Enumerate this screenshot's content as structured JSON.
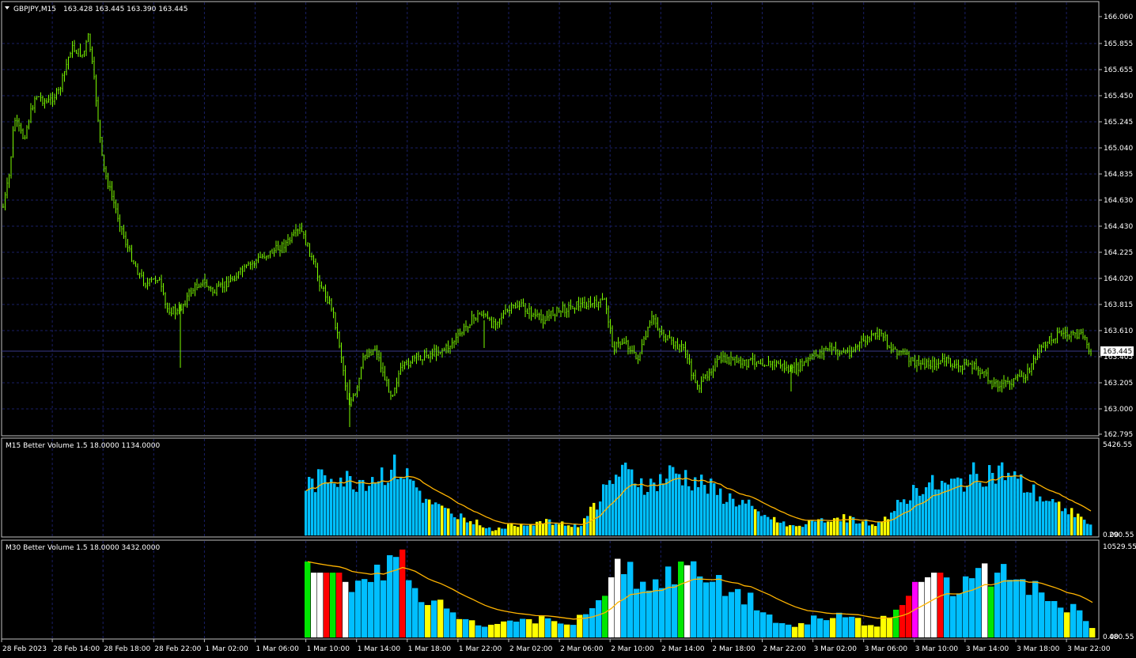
{
  "main_chart": {
    "symbol_header": "GBPJPY,M15",
    "ohlc": "163.428 163.445 163.390 163.445",
    "current_price": "163.445",
    "price_ticks": [
      "166.060",
      "165.855",
      "165.655",
      "165.450",
      "165.245",
      "165.040",
      "164.835",
      "164.630",
      "164.430",
      "164.225",
      "164.020",
      "163.815",
      "163.610",
      "163.405",
      "163.205",
      "163.000",
      "162.795"
    ],
    "candle_color": "#7cfc00",
    "grid_color": "#1a1f66"
  },
  "time_axis": {
    "labels": [
      "28 Feb 2023",
      "28 Feb 14:00",
      "28 Feb 18:00",
      "28 Feb 22:00",
      "1 Mar 02:00",
      "1 Mar 06:00",
      "1 Mar 10:00",
      "1 Mar 14:00",
      "1 Mar 18:00",
      "1 Mar 22:00",
      "2 Mar 02:00",
      "2 Mar 06:00",
      "2 Mar 10:00",
      "2 Mar 14:00",
      "2 Mar 18:00",
      "2 Mar 22:00",
      "3 Mar 02:00",
      "3 Mar 06:00",
      "3 Mar 10:00",
      "3 Mar 14:00",
      "3 Mar 18:00",
      "3 Mar 22:00"
    ]
  },
  "m15_indicator": {
    "header": "M15 Better Volume 1.5 18.0000 1134.0000",
    "max_label": "5426.55",
    "min_label": "0.00",
    "min_label2": "290.55"
  },
  "m30_indicator": {
    "header": "M30 Better Volume 1.5 18.0000 3432.0000",
    "max_label": "10529.55",
    "min_label": "0.00",
    "min_label2": "480.55"
  },
  "colors": {
    "volume_blue": "#00bfff",
    "volume_yellow": "#ffff00",
    "volume_green": "#00e600",
    "volume_red": "#ff0000",
    "volume_white": "#ffffff",
    "volume_magenta": "#ff00ff",
    "ma_line": "#ffb400",
    "frame": "#c0c0c0"
  }
}
